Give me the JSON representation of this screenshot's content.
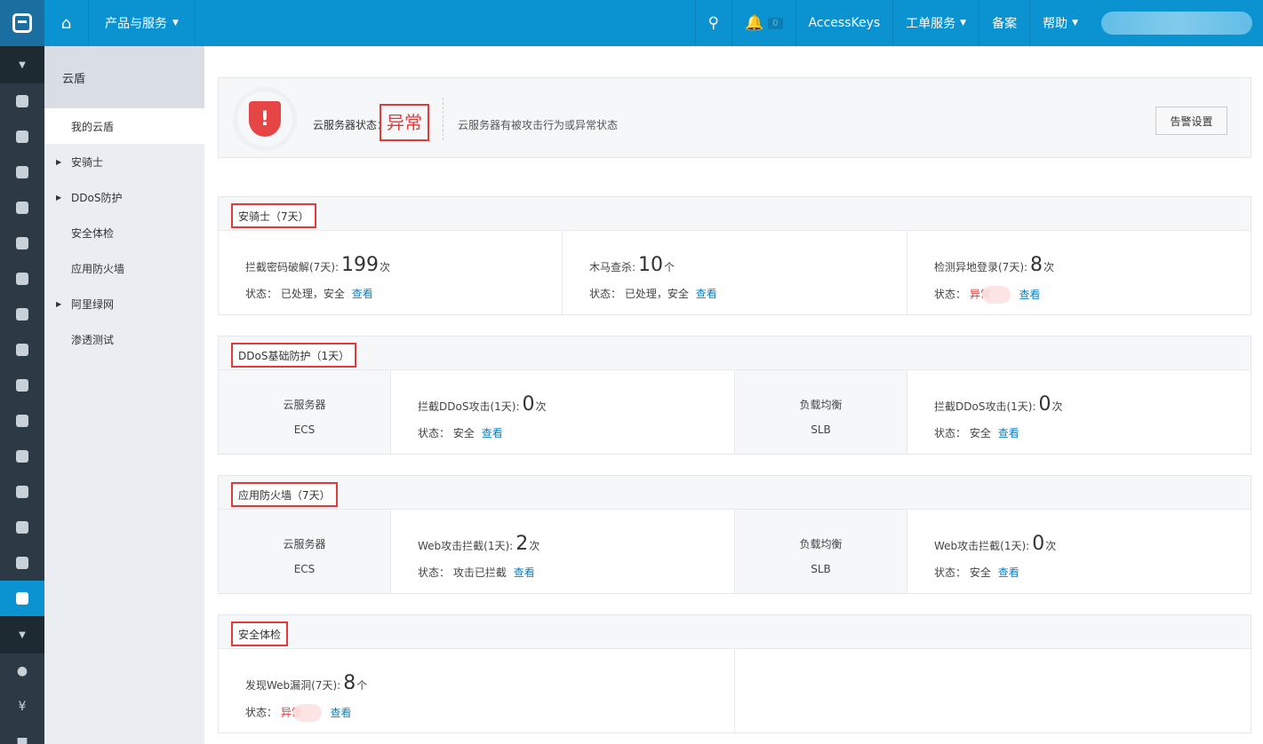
{
  "topbar": {
    "products_label": "产品与服务",
    "notification_count": "0",
    "accesskeys_label": "AccessKeys",
    "ticket_label": "工单服务",
    "beian_label": "备案",
    "help_label": "帮助"
  },
  "subnav": {
    "title": "云盾",
    "items": [
      {
        "label": "我的云盾",
        "active": true,
        "expandable": false
      },
      {
        "label": "安骑士",
        "active": false,
        "expandable": true
      },
      {
        "label": "DDoS防护",
        "active": false,
        "expandable": true
      },
      {
        "label": "安全体检",
        "active": false,
        "expandable": false
      },
      {
        "label": "应用防火墙",
        "active": false,
        "expandable": false
      },
      {
        "label": "阿里绿网",
        "active": false,
        "expandable": true
      },
      {
        "label": "渗透测试",
        "active": false,
        "expandable": false
      }
    ]
  },
  "status": {
    "shield_symbol": "!",
    "label": "云服务器状态：",
    "value": "异常",
    "description": "云服务器有被攻击行为或异常状态",
    "alarm_button": "告警设置"
  },
  "aqs": {
    "title": "安骑士（7天）",
    "cells": [
      {
        "prefix": "拦截密码破解(7天):",
        "num": "199",
        "unit": "次",
        "state_prefix": "状态：",
        "state": "已处理，安全",
        "link": "查看"
      },
      {
        "prefix": "木马查杀:",
        "num": "10",
        "unit": "个",
        "state_prefix": "状态：",
        "state": "已处理，安全",
        "link": "查看"
      },
      {
        "prefix": "检测异地登录(7天):",
        "num": "8",
        "unit": "次",
        "state_prefix": "状态：",
        "state": "异常",
        "link": "查看"
      }
    ]
  },
  "ddos": {
    "title": "DDoS基础防护（1天）",
    "ecs_name": "云服务器",
    "ecs_code": "ECS",
    "ecs_prefix": "拦截DDoS攻击(1天):",
    "ecs_num": "0",
    "ecs_unit": "次",
    "ecs_state_prefix": "状态：",
    "ecs_state": "安全",
    "ecs_link": "查看",
    "slb_name": "负载均衡",
    "slb_code": "SLB",
    "slb_prefix": "拦截DDoS攻击(1天):",
    "slb_num": "0",
    "slb_unit": "次",
    "slb_state_prefix": "状态：",
    "slb_state": "安全",
    "slb_link": "查看"
  },
  "waf": {
    "title": "应用防火墙（7天）",
    "ecs_name": "云服务器",
    "ecs_code": "ECS",
    "ecs_prefix": "Web攻击拦截(1天):",
    "ecs_num": "2",
    "ecs_unit": "次",
    "ecs_state_prefix": "状态：",
    "ecs_state": "攻击已拦截",
    "ecs_link": "查看",
    "slb_name": "负载均衡",
    "slb_code": "SLB",
    "slb_prefix": "Web攻击拦截(1天):",
    "slb_num": "0",
    "slb_unit": "次",
    "slb_state_prefix": "状态：",
    "slb_state": "安全",
    "slb_link": "查看"
  },
  "scan": {
    "title": "安全体检",
    "prefix": "发现Web漏洞(7天):",
    "num": "8",
    "unit": "个",
    "state_prefix": "状态：",
    "state": "异常",
    "link": "查看"
  },
  "colors": {
    "topbar": "#0a93d0",
    "iconbar": "#2b3a45",
    "danger": "#e23a3a",
    "link": "#0a7fc2"
  }
}
